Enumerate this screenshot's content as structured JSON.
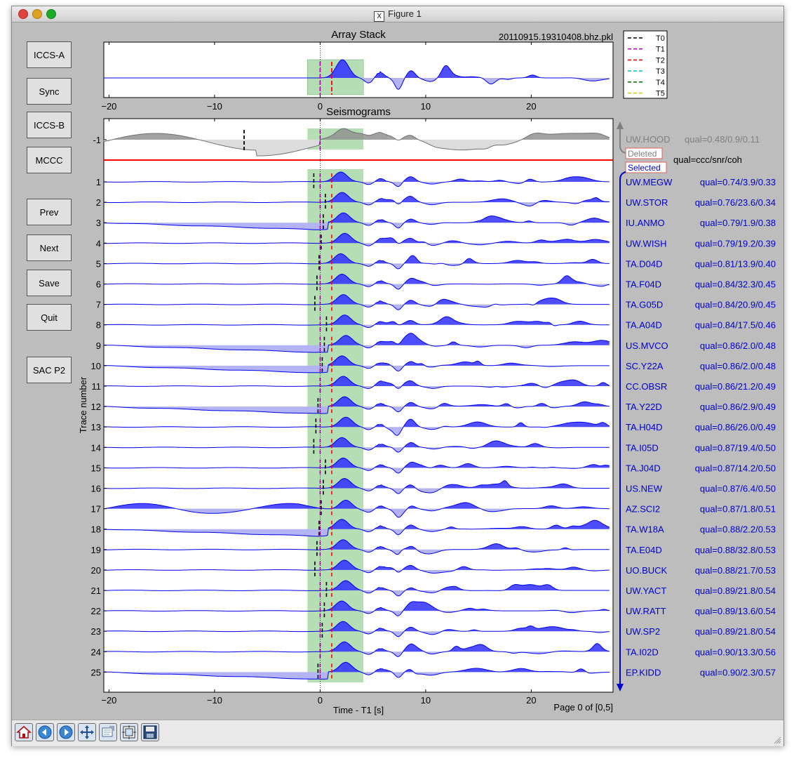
{
  "window": {
    "title": "Figure 1",
    "x11_glyph": "X"
  },
  "buttons": [
    {
      "key": "iccs_a",
      "label": "ICCS-A"
    },
    {
      "key": "sync",
      "label": "Sync"
    },
    {
      "key": "iccs_b",
      "label": "ICCS-B"
    },
    {
      "key": "mccc",
      "label": "MCCC"
    },
    {
      "key": "prev",
      "label": "Prev"
    },
    {
      "key": "next",
      "label": "Next"
    },
    {
      "key": "save",
      "label": "Save"
    },
    {
      "key": "quit",
      "label": "Quit"
    },
    {
      "key": "sac_p2",
      "label": "SAC P2"
    }
  ],
  "stack": {
    "title": "Array Stack",
    "filename": "20110915.19310408.bhz.pkl",
    "xlim": [
      -20.5,
      27.5
    ],
    "xticks": [
      -20,
      -10,
      0,
      10,
      20
    ],
    "xtick_labels": [
      "−20",
      "−10",
      "0",
      "10",
      "20"
    ]
  },
  "legend": [
    {
      "label": "T0",
      "color": "#000000"
    },
    {
      "label": "T1",
      "color": "#cc00cc"
    },
    {
      "label": "T2",
      "color": "#ff0000"
    },
    {
      "label": "T3",
      "color": "#00cccc"
    },
    {
      "label": "T4",
      "color": "#008000"
    },
    {
      "label": "T5",
      "color": "#cccc00"
    }
  ],
  "seismo": {
    "title": "Seismograms",
    "xlabel": "Time - T1 [s]",
    "ylabel": "Trace number",
    "page_text": "Page 0 of [0,5]",
    "xlim": [
      -20.5,
      27.5
    ],
    "xticks": [
      -20,
      -10,
      0,
      10,
      20
    ],
    "xtick_labels": [
      "−20",
      "−10",
      "0",
      "10",
      "20"
    ],
    "window": [
      -1.2,
      4.1
    ],
    "t2": 1.1,
    "deleted_label": "Deleted",
    "selected_label": "Selected",
    "qual_header": "qual=ccc/snr/coh",
    "deleted_trace": {
      "num": "-1",
      "station": "UW.HOOD",
      "qual": "qual=0.48/0.9/0.11"
    },
    "traces": [
      {
        "num": "1",
        "station": "UW.MEGW",
        "qual": "qual=0.74/3.9/0.33"
      },
      {
        "num": "2",
        "station": "UW.STOR",
        "qual": "qual=0.76/23.6/0.34"
      },
      {
        "num": "3",
        "station": "IU.ANMO",
        "qual": "qual=0.79/1.9/0.38"
      },
      {
        "num": "4",
        "station": "UW.WISH",
        "qual": "qual=0.79/19.2/0.39"
      },
      {
        "num": "5",
        "station": "TA.D04D",
        "qual": "qual=0.81/13.9/0.40"
      },
      {
        "num": "6",
        "station": "TA.F04D",
        "qual": "qual=0.84/32.3/0.45"
      },
      {
        "num": "7",
        "station": "TA.G05D",
        "qual": "qual=0.84/20.9/0.45"
      },
      {
        "num": "8",
        "station": "TA.A04D",
        "qual": "qual=0.84/17.5/0.46"
      },
      {
        "num": "9",
        "station": "US.MVCO",
        "qual": "qual=0.86/2.0/0.48"
      },
      {
        "num": "10",
        "station": "SC.Y22A",
        "qual": "qual=0.86/2.0/0.48"
      },
      {
        "num": "11",
        "station": "CC.OBSR",
        "qual": "qual=0.86/21.2/0.49"
      },
      {
        "num": "12",
        "station": "TA.Y22D",
        "qual": "qual=0.86/2.9/0.49"
      },
      {
        "num": "13",
        "station": "TA.H04D",
        "qual": "qual=0.86/26.0/0.49"
      },
      {
        "num": "14",
        "station": "TA.I05D",
        "qual": "qual=0.87/19.4/0.50"
      },
      {
        "num": "15",
        "station": "TA.J04D",
        "qual": "qual=0.87/14.2/0.50"
      },
      {
        "num": "16",
        "station": "US.NEW",
        "qual": "qual=0.87/6.4/0.50"
      },
      {
        "num": "17",
        "station": "AZ.SCI2",
        "qual": "qual=0.87/1.8/0.51"
      },
      {
        "num": "18",
        "station": "TA.W18A",
        "qual": "qual=0.88/2.2/0.53"
      },
      {
        "num": "19",
        "station": "TA.E04D",
        "qual": "qual=0.88/32.8/0.53"
      },
      {
        "num": "20",
        "station": "UO.BUCK",
        "qual": "qual=0.88/21.7/0.53"
      },
      {
        "num": "21",
        "station": "UW.YACT",
        "qual": "qual=0.89/21.8/0.54"
      },
      {
        "num": "22",
        "station": "UW.RATT",
        "qual": "qual=0.89/13.6/0.54"
      },
      {
        "num": "23",
        "station": "UW.SP2",
        "qual": "qual=0.89/21.8/0.54"
      },
      {
        "num": "24",
        "station": "TA.I02D",
        "qual": "qual=0.90/13.3/0.56"
      },
      {
        "num": "25",
        "station": "EP.KIDD",
        "qual": "qual=0.90/2.3/0.57"
      }
    ]
  },
  "toolbar": [
    "home-icon",
    "back-icon",
    "forward-icon",
    "pan-icon",
    "zoom-icon",
    "subplots-icon",
    "save-icon"
  ],
  "colors": {
    "trace": "#0000ee",
    "fill": "#2f2fff",
    "fill_light": "#b4b4f4",
    "window": "#a8d8a8",
    "t2": "#ff0000",
    "t1": "#cc00cc",
    "deleted": "#808080",
    "separator": "#ff0000",
    "selected": "#0000cc"
  }
}
